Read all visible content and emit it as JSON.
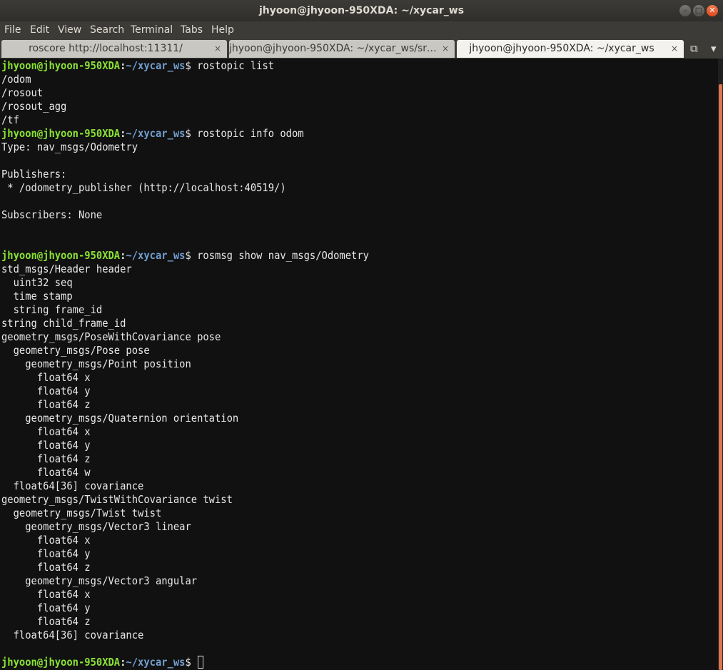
{
  "window": {
    "title": "jhyoon@jhyoon-950XDA: ~/xycar_ws"
  },
  "window_controls": {
    "minimize": "–",
    "maximize": "□",
    "close": "✕"
  },
  "menu": [
    "File",
    "Edit",
    "View",
    "Search",
    "Terminal",
    "Tabs",
    "Help"
  ],
  "tabs": [
    {
      "label": "roscore http://localhost:11311/",
      "close": "×",
      "active": false
    },
    {
      "label": "jhyoon@jhyoon-950XDA: ~/xycar_ws/src/...",
      "close": "×",
      "active": false
    },
    {
      "label": "jhyoon@jhyoon-950XDA: ~/xycar_ws",
      "close": "×",
      "active": true
    }
  ],
  "tab_tools": {
    "new_tab_icon": "new-tab-icon",
    "new_tab_glyph": "⧉",
    "menu_glyph": "▾"
  },
  "colors": {
    "prompt_user": "#8ae234",
    "prompt_path": "#729fcf",
    "scroll_thumb": "#e0744a"
  },
  "prompt": {
    "user": "jhyoon@jhyoon-950XDA",
    "colon": ":",
    "path": "~/xycar_ws",
    "symbol": "$ "
  },
  "terminal": [
    {
      "type": "prompt",
      "cmd": "rostopic list"
    },
    {
      "type": "out",
      "text": "/odom"
    },
    {
      "type": "out",
      "text": "/rosout"
    },
    {
      "type": "out",
      "text": "/rosout_agg"
    },
    {
      "type": "out",
      "text": "/tf"
    },
    {
      "type": "prompt",
      "cmd": "rostopic info odom"
    },
    {
      "type": "out",
      "text": "Type: nav_msgs/Odometry"
    },
    {
      "type": "out",
      "text": ""
    },
    {
      "type": "out",
      "text": "Publishers:"
    },
    {
      "type": "out",
      "text": " * /odometry_publisher (http://localhost:40519/)"
    },
    {
      "type": "out",
      "text": ""
    },
    {
      "type": "out",
      "text": "Subscribers: None"
    },
    {
      "type": "out",
      "text": ""
    },
    {
      "type": "out",
      "text": ""
    },
    {
      "type": "prompt",
      "cmd": "rosmsg show nav_msgs/Odometry"
    },
    {
      "type": "out",
      "text": "std_msgs/Header header"
    },
    {
      "type": "out",
      "text": "  uint32 seq"
    },
    {
      "type": "out",
      "text": "  time stamp"
    },
    {
      "type": "out",
      "text": "  string frame_id"
    },
    {
      "type": "out",
      "text": "string child_frame_id"
    },
    {
      "type": "out",
      "text": "geometry_msgs/PoseWithCovariance pose"
    },
    {
      "type": "out",
      "text": "  geometry_msgs/Pose pose"
    },
    {
      "type": "out",
      "text": "    geometry_msgs/Point position"
    },
    {
      "type": "out",
      "text": "      float64 x"
    },
    {
      "type": "out",
      "text": "      float64 y"
    },
    {
      "type": "out",
      "text": "      float64 z"
    },
    {
      "type": "out",
      "text": "    geometry_msgs/Quaternion orientation"
    },
    {
      "type": "out",
      "text": "      float64 x"
    },
    {
      "type": "out",
      "text": "      float64 y"
    },
    {
      "type": "out",
      "text": "      float64 z"
    },
    {
      "type": "out",
      "text": "      float64 w"
    },
    {
      "type": "out",
      "text": "  float64[36] covariance"
    },
    {
      "type": "out",
      "text": "geometry_msgs/TwistWithCovariance twist"
    },
    {
      "type": "out",
      "text": "  geometry_msgs/Twist twist"
    },
    {
      "type": "out",
      "text": "    geometry_msgs/Vector3 linear"
    },
    {
      "type": "out",
      "text": "      float64 x"
    },
    {
      "type": "out",
      "text": "      float64 y"
    },
    {
      "type": "out",
      "text": "      float64 z"
    },
    {
      "type": "out",
      "text": "    geometry_msgs/Vector3 angular"
    },
    {
      "type": "out",
      "text": "      float64 x"
    },
    {
      "type": "out",
      "text": "      float64 y"
    },
    {
      "type": "out",
      "text": "      float64 z"
    },
    {
      "type": "out",
      "text": "  float64[36] covariance"
    },
    {
      "type": "out",
      "text": ""
    },
    {
      "type": "prompt",
      "cmd": "",
      "cursor": true
    }
  ]
}
